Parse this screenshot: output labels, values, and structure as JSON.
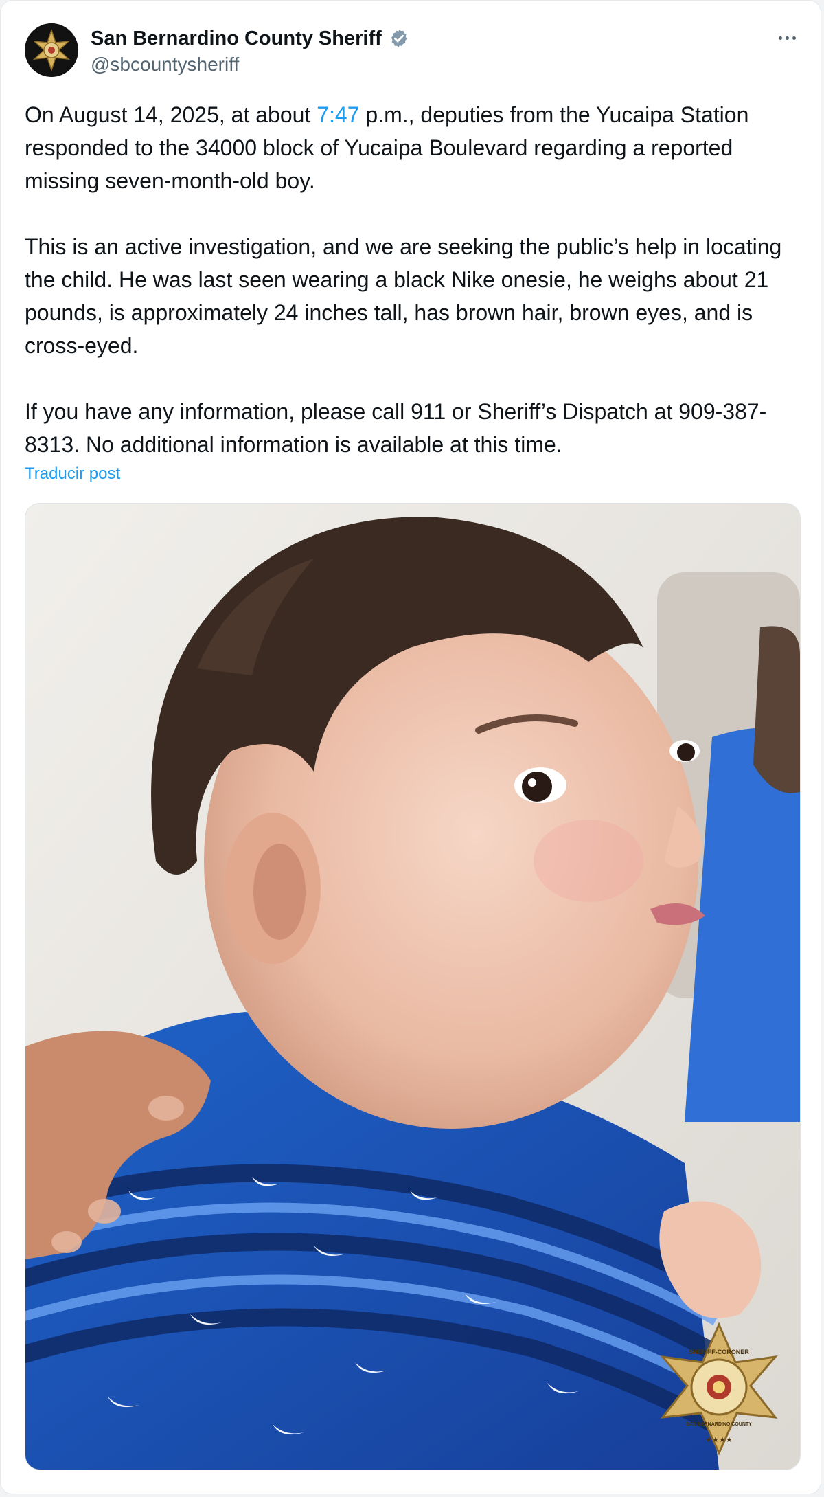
{
  "post": {
    "author": {
      "display_name": "San Bernardino County Sheriff",
      "handle": "@sbcountysheriff",
      "verified": true,
      "avatar_icon": "sheriff-star-badge-icon"
    },
    "more_icon": "more-options-icon",
    "paragraphs": [
      {
        "before_link": "On August 14, 2025, at about ",
        "link_text": "7:47",
        "after_link": " p.m., deputies from the Yucaipa Station responded to the 34000 block of Yucaipa Boulevard regarding a reported missing seven-month-old boy."
      },
      {
        "text": "This is an active investigation, and we are seeking the public’s help in locating the child. He was last seen wearing a black Nike onesie, he weighs about 21 pounds, is approximately 24 inches tall, has brown hair, brown eyes, and is cross-eyed."
      },
      {
        "text": "If you have any information, please call 911 or Sheriff’s Dispatch at 909-387-8313. No additional information is available at this time."
      }
    ],
    "translate_label": "Traducir post",
    "media": {
      "badge_text_top": "SHERIFF-CORONER",
      "badge_text_bottom": "SAN BERNARDINO COUNTY",
      "badge_stars": "★★★★"
    }
  },
  "colors": {
    "link": "#1d9bf0",
    "text": "#0f1419",
    "secondary": "#536471",
    "shirt_blue": "#1f5fc7"
  }
}
